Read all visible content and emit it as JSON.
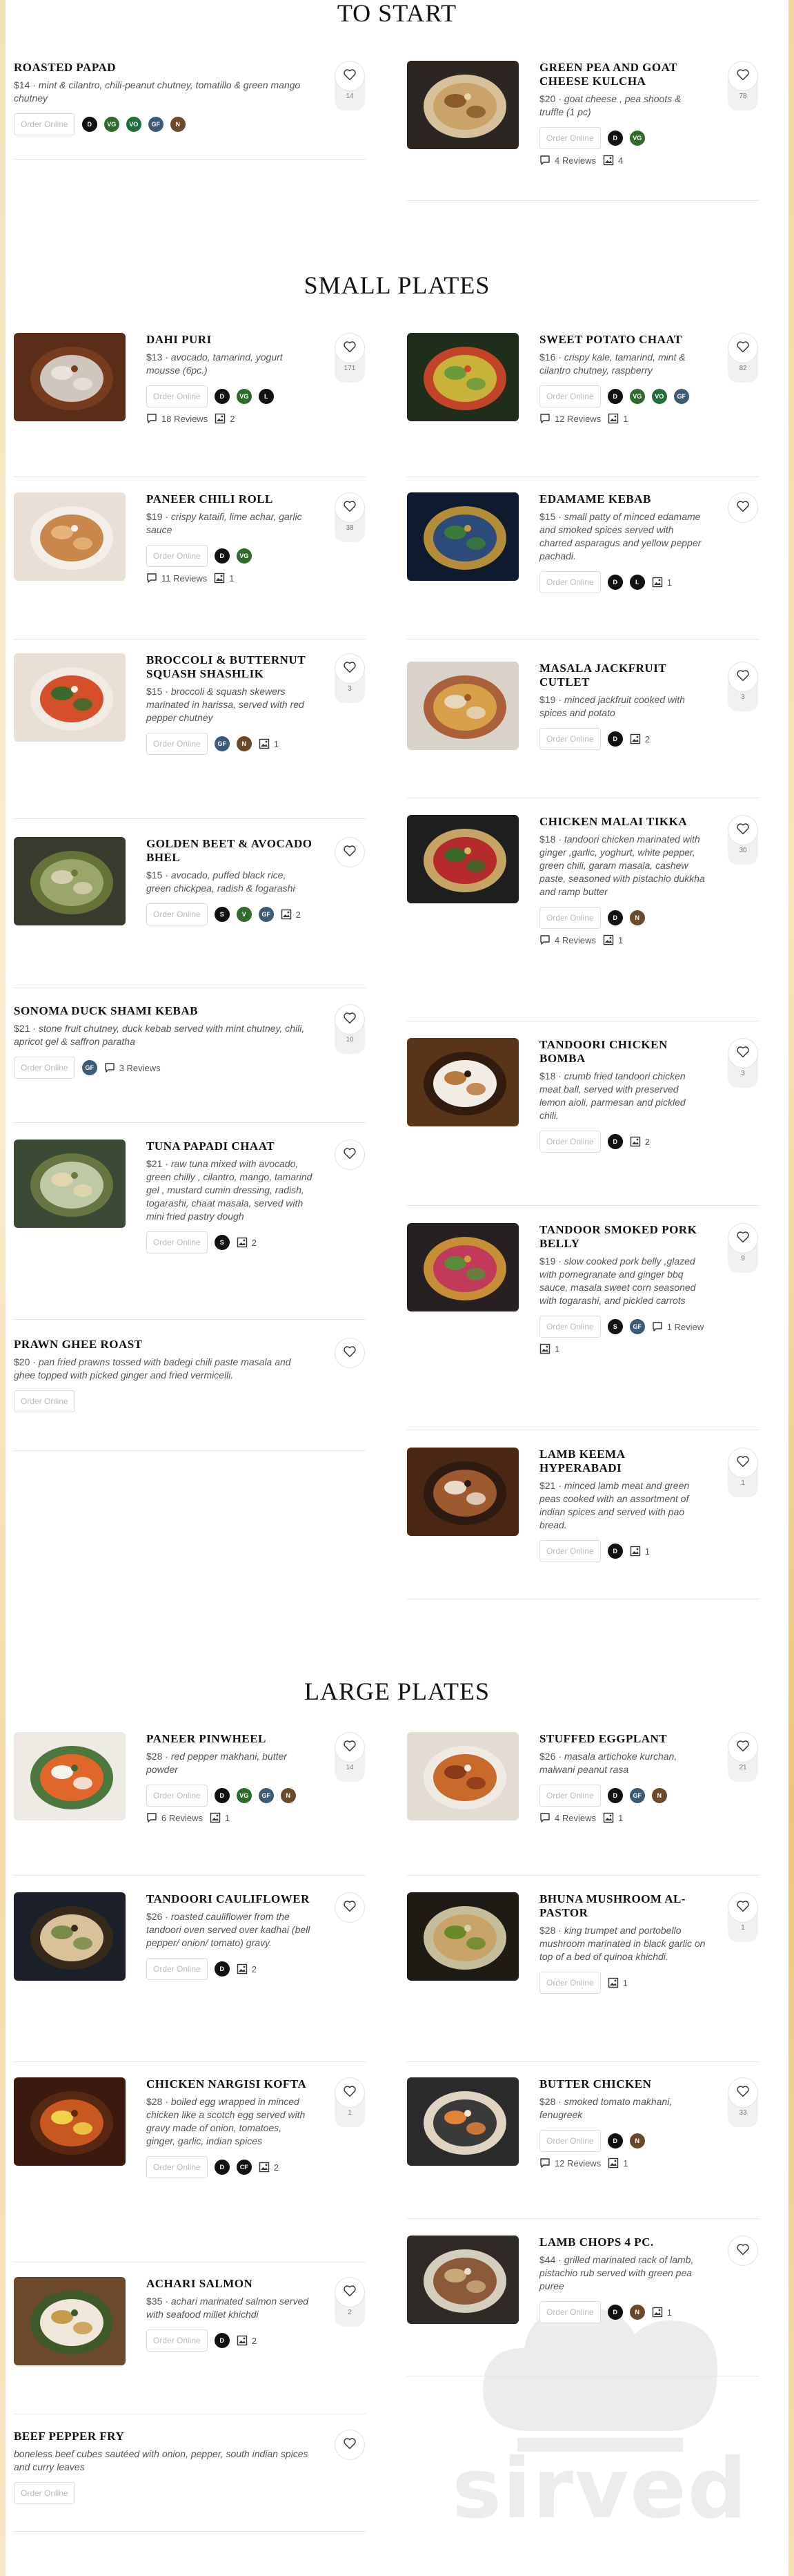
{
  "colors": {
    "D": "#111111",
    "VG": "#2f6b2a",
    "VO": "#1f6f3a",
    "GF": "#3d5a76",
    "N": "#6b4a2b",
    "L": "#111111",
    "S": "#111111",
    "V": "#2f6b2a"
  },
  "sections": [
    {
      "title": "TO START",
      "items": [
        {
          "name": "ROASTED PAPAD",
          "price": "$14",
          "description": "mint & cilantro, chili-peanut chutney, tomatillo & green mango chutney",
          "order": "Order Online",
          "badges": [
            "D",
            "VG",
            "VO",
            "GF",
            "N"
          ],
          "likes": "14"
        },
        {
          "name": "GREEN PEA AND GOAT CHEESE KULCHA",
          "price": "$20",
          "description": "goat cheese , pea shoots & truffle (1 pc)",
          "order": "Order Online",
          "badges": [
            "D",
            "VG"
          ],
          "reviews": "4 Reviews",
          "photos": "4",
          "likes": "78",
          "image": "kulcha"
        }
      ]
    },
    {
      "title": "SMALL PLATES",
      "items": [
        {
          "name": "DAHI PURI",
          "price": "$13",
          "description": "avocado, tamarind, yogurt mousse (6pc.)",
          "order": "Order Online",
          "badges": [
            "D",
            "VG",
            "L"
          ],
          "reviews": "18 Reviews",
          "photos": "2",
          "likes": "171",
          "image": "puri"
        },
        {
          "name": "SWEET POTATO CHAAT",
          "price": "$16",
          "description": "crispy kale, tamarind, mint & cilantro chutney, raspberry",
          "order": "Order Online",
          "badges": [
            "D",
            "VG",
            "VO",
            "GF"
          ],
          "reviews": "12 Reviews",
          "photos": "1",
          "likes": "82",
          "image": "chaat"
        },
        {
          "name": "PANEER CHILI ROLL",
          "price": "$19",
          "description": "crispy kataifi, lime achar, garlic sauce",
          "order": "Order Online",
          "badges": [
            "D",
            "VG"
          ],
          "reviews": "11 Reviews",
          "photos": "1",
          "likes": "38",
          "image": "roll"
        },
        {
          "name": "EDAMAME KEBAB",
          "price": "$15",
          "description": "small patty of minced edamame and smoked spices served with charred asparagus and yellow pepper pachadi.",
          "order": "Order Online",
          "badges": [
            "D",
            "L"
          ],
          "photos": "1",
          "image": "edamame"
        },
        {
          "name": "BROCCOLI & BUTTERNUT SQUASH SHASHLIK",
          "price": "$15",
          "description": "broccoli & squash skewers marinated in harissa, served with red pepper chutney",
          "order": "Order Online",
          "badges": [
            "GF",
            "N"
          ],
          "photos": "1",
          "likes": "3",
          "image": "shashlik"
        },
        {
          "name": "MASALA JACKFRUIT CUTLET",
          "price": "$19",
          "description": "minced jackfruit cooked with spices and potato",
          "order": "Order Online",
          "badges": [
            "D"
          ],
          "photos": "2",
          "likes": "3",
          "image": "cutlet"
        },
        {
          "name": "GOLDEN BEET & AVOCADO BHEL",
          "price": "$15",
          "description": "avocado, puffed black rice, green chickpea, radish & fogarashi",
          "order": "Order Online",
          "badges": [
            "S",
            "V",
            "GF"
          ],
          "photos": "2",
          "image": "bhel"
        },
        {
          "name": "CHICKEN MALAI TIKKA",
          "price": "$18",
          "description": "tandoori chicken marinated with ginger ,garlic, yoghurt, white pepper, green chili, garam masala, cashew paste, seasoned with pistachio dukkha and ramp butter",
          "order": "Order Online",
          "badges": [
            "D",
            "N"
          ],
          "reviews": "4 Reviews",
          "photos": "1",
          "likes": "30",
          "image": "tikka"
        },
        {
          "name": "SONOMA DUCK SHAMI KEBAB",
          "price": "$21",
          "description": "stone fruit chutney, duck kebab served with mint chutney, chili, apricot gel & saffron paratha",
          "order": "Order Online",
          "badges": [
            "GF"
          ],
          "reviews": "3 Reviews",
          "likes": "10"
        },
        {
          "name": "TANDOORI CHICKEN BOMBA",
          "price": "$18",
          "description": "crumb fried tandoori chicken meat ball, served with preserved lemon aioli, parmesan and pickled chili.",
          "order": "Order Online",
          "badges": [
            "D"
          ],
          "photos": "2",
          "likes": "3",
          "image": "bomba"
        },
        {
          "name": "TUNA PAPADI CHAAT",
          "price": "$21",
          "description": "raw tuna mixed with avocado, green chilly , cilantro, mango, tamarind gel , mustard cumin dressing, radish, togarashi, chaat masala, served with mini fried pastry dough",
          "order": "Order Online",
          "badges": [
            "S"
          ],
          "photos": "2",
          "image": "tuna"
        },
        {
          "name": "TANDOOR SMOKED PORK BELLY",
          "price": "$19",
          "description": "slow cooked pork belly ,glazed with pomegranate and ginger bbq sauce, masala sweet corn seasoned with togarashi, and pickled carrots",
          "order": "Order Online",
          "badges": [
            "S",
            "GF"
          ],
          "reviews": "1 Review",
          "photos": "1",
          "likes": "9",
          "image": "pork"
        },
        {
          "name": "PRAWN GHEE ROAST",
          "price": "$20",
          "description": "pan fried prawns tossed with badegi chili paste masala and ghee topped with picked ginger and fried vermicelli.",
          "order": "Order Online"
        },
        {
          "name": "LAMB KEEMA HYPERABADI",
          "price": "$21",
          "description": "minced lamb meat and green peas cooked with an assortment of indian spices and served with pao bread.",
          "order": "Order Online",
          "badges": [
            "D"
          ],
          "photos": "1",
          "likes": "1",
          "image": "keema"
        }
      ]
    },
    {
      "title": "LARGE PLATES",
      "items": [
        {
          "name": "PANEER PINWHEEL",
          "price": "$28",
          "description": "red pepper makhani, butter powder",
          "order": "Order Online",
          "badges": [
            "D",
            "VG",
            "GF",
            "N"
          ],
          "reviews": "6 Reviews",
          "photos": "1",
          "likes": "14",
          "image": "pinwheel"
        },
        {
          "name": "STUFFED EGGPLANT",
          "price": "$26",
          "description": "masala artichoke kurchan, malwani peanut rasa",
          "order": "Order Online",
          "badges": [
            "D",
            "GF",
            "N"
          ],
          "reviews": "4 Reviews",
          "photos": "1",
          "likes": "21",
          "image": "eggplant"
        },
        {
          "name": "TANDOORI CAULIFLOWER",
          "price": "$26",
          "description": "roasted cauliflower from the tandoori oven served over kadhai (bell pepper/ onion/ tomato) gravy.",
          "order": "Order Online",
          "badges": [
            "D"
          ],
          "photos": "2",
          "image": "cauli"
        },
        {
          "name": "BHUNA MUSHROOM AL-PASTOR",
          "price": "$28",
          "description": "king trumpet and portobello mushroom marinated in black garlic on top of a bed of quinoa khichdi.",
          "order": "Order Online",
          "photos": "1",
          "likes": "1",
          "image": "mushroom"
        },
        {
          "name": "CHICKEN NARGISI KOFTA",
          "price": "$28",
          "description": "boiled egg wrapped in minced chicken like a scotch egg served with gravy made of onion, tomatoes, ginger, garlic, indian spices",
          "order": "Order Online",
          "badges": [
            "D",
            "CF"
          ],
          "photos": "2",
          "likes": "1",
          "image": "kofta"
        },
        {
          "name": "BUTTER CHICKEN",
          "price": "$28",
          "description": "smoked tomato makhani, fenugreek",
          "order": "Order Online",
          "badges": [
            "D",
            "N"
          ],
          "reviews": "12 Reviews",
          "photos": "1",
          "likes": "33",
          "image": "butter"
        },
        {
          "name": "ACHARI SALMON",
          "price": "$35",
          "description": "achari marinated salmon served with seafood millet khichdi",
          "order": "Order Online",
          "badges": [
            "D"
          ],
          "photos": "2",
          "likes": "2",
          "image": "salmon"
        },
        {
          "name": "LAMB CHOPS 4 PC.",
          "price": "$44",
          "description": "grilled marinated rack of lamb, pistachio rub served with green pea puree",
          "order": "Order Online",
          "badges": [
            "D",
            "N"
          ],
          "photos": "1",
          "image": "lamb"
        },
        {
          "name": "BEEF PEPPER FRY",
          "description": "boneless beef cubes sautéed with onion, pepper, south indian spices and curry leaves",
          "order": "Order Online"
        }
      ]
    }
  ],
  "watermark": "sirved"
}
